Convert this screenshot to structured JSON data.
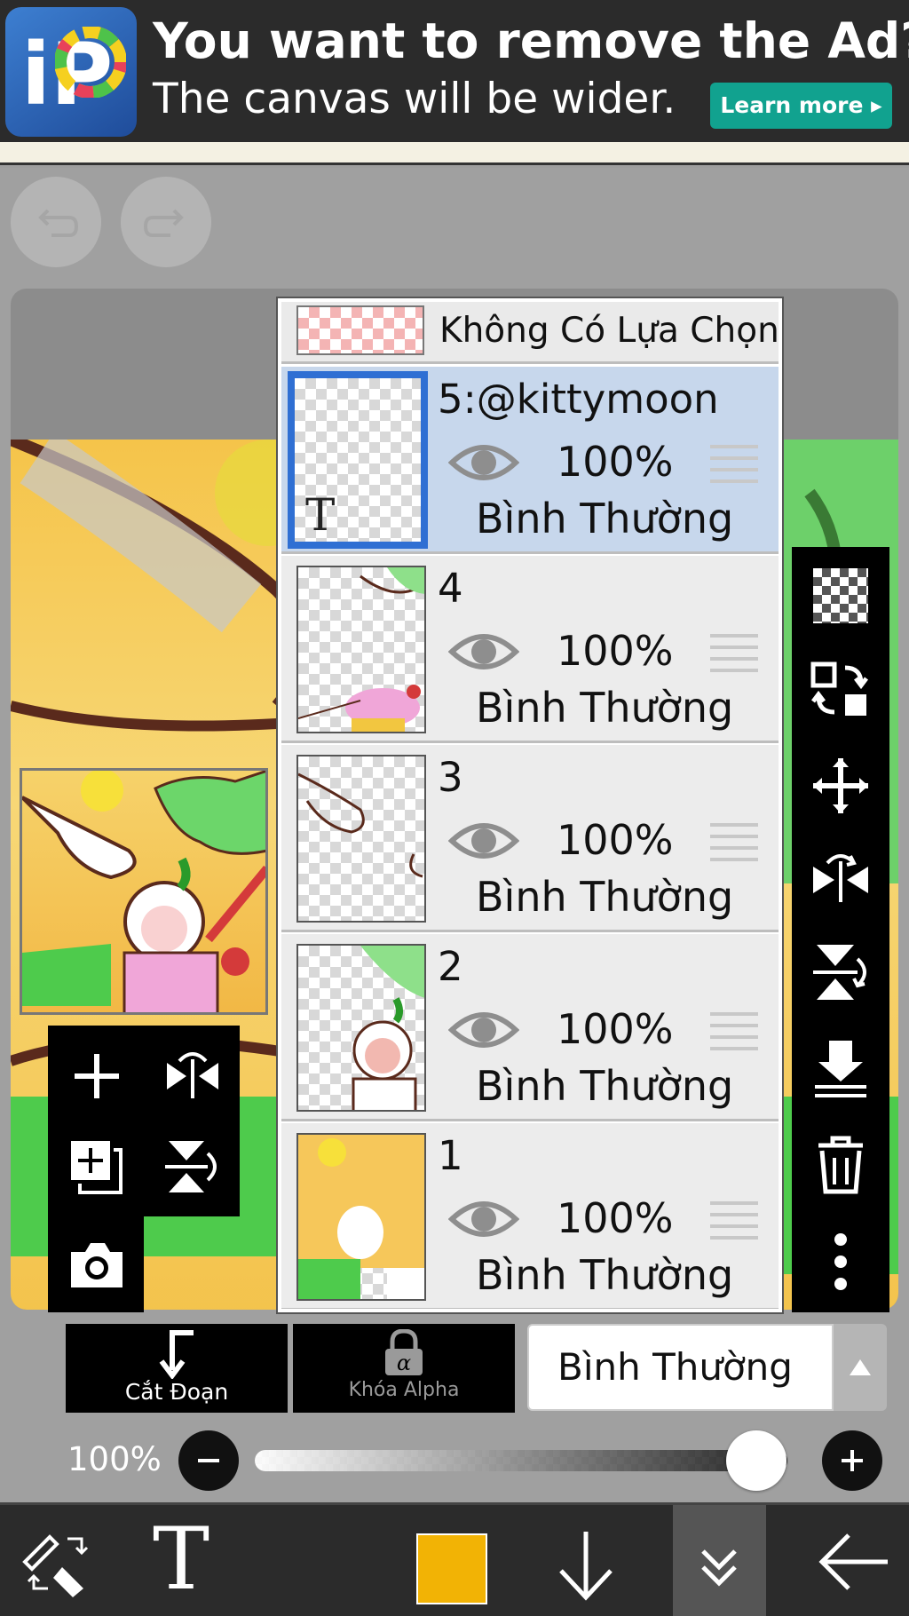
{
  "ad": {
    "title": "You want to remove the Ad?",
    "subtitle": "The canvas will be wider.",
    "button": "Learn more ▸",
    "logo_text": "iP"
  },
  "layers_panel": {
    "no_selection_label": "Không Có Lựa Chọn",
    "layers": [
      {
        "name": "5:@kittymoon",
        "opacity": "100%",
        "blend": "Bình Thường",
        "selected": true
      },
      {
        "name": "4",
        "opacity": "100%",
        "blend": "Bình Thường",
        "selected": false
      },
      {
        "name": "3",
        "opacity": "100%",
        "blend": "Bình Thường",
        "selected": false
      },
      {
        "name": "2",
        "opacity": "100%",
        "blend": "Bình Thường",
        "selected": false
      },
      {
        "name": "1",
        "opacity": "100%",
        "blend": "Bình Thường",
        "selected": false
      }
    ],
    "text_layer_glyph": "T"
  },
  "actions": {
    "clipping_label": "Cắt Đoạn",
    "alpha_lock_label": "Khóa Alpha",
    "blend_mode": "Bình Thường"
  },
  "opacity": {
    "label": "100%",
    "value": 1.0
  },
  "bottom_bar": {
    "text_tool": "T",
    "current_color": "#f2b305"
  },
  "colors": {
    "accent_selected": "#2f6fd3",
    "selected_row": "#c7d7ec",
    "ad_button": "#11a28f"
  }
}
